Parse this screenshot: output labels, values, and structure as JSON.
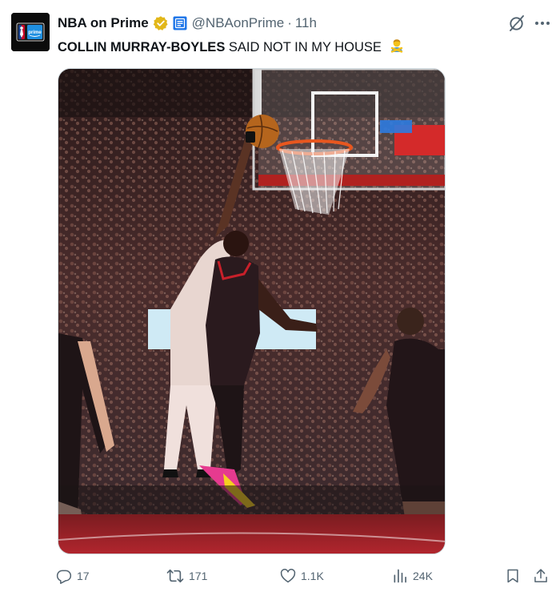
{
  "tweet": {
    "author_name": "NBA on Prime",
    "handle": "@NBAonPrime",
    "separator": "·",
    "time": "11h",
    "text_bold": "COLLIN MURRAY-BOYLES",
    "text_rest": " SAID NOT IN MY HOUSE",
    "emoji": "🙅‍♂️",
    "media": {
      "type": "video",
      "description": "basketball block at the rim"
    }
  },
  "avatar": {
    "logo_small_text": "prime"
  },
  "actions": {
    "replies": "17",
    "reposts": "171",
    "likes": "1.1K",
    "views": "24K"
  },
  "icons": {
    "verified": "verified-badge-icon",
    "affiliate": "affiliate-badge-icon",
    "grok": "grok-icon",
    "more": "more-icon",
    "reply": "reply-icon",
    "repost": "repost-icon",
    "like": "like-icon",
    "views": "views-icon",
    "bookmark": "bookmark-icon",
    "share": "share-icon"
  },
  "colors": {
    "text_primary": "#0f1419",
    "text_secondary": "#536471",
    "verified_gold": "#e2b719",
    "affiliate_blue": "#1d75e8",
    "court_red": "#b3262e"
  }
}
